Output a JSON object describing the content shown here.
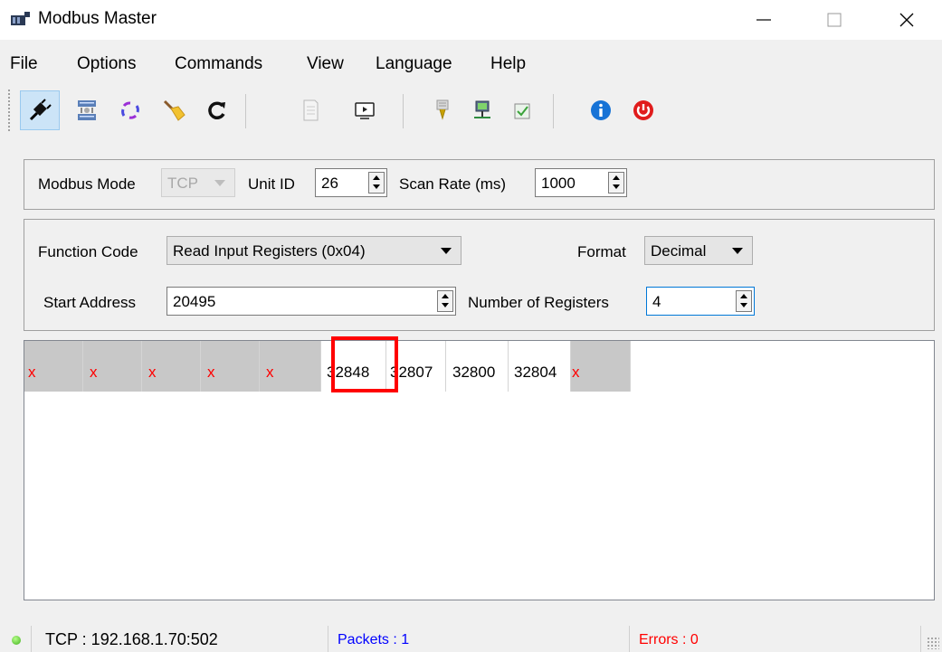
{
  "window": {
    "title": "Modbus Master"
  },
  "menu": [
    "File",
    "Options",
    "Commands",
    "View",
    "Language",
    "Help"
  ],
  "toolbar": {
    "buttons": [
      {
        "icon": "connect-plug-icon",
        "active": true
      },
      {
        "icon": "network-settings-icon"
      },
      {
        "icon": "scan-cycle-icon"
      },
      {
        "icon": "clear-broom-icon"
      },
      {
        "icon": "refresh-icon"
      },
      {
        "icon": "log-document-icon"
      },
      {
        "icon": "bus-monitor-icon"
      },
      {
        "icon": "tools-icon"
      },
      {
        "icon": "network-computer-icon"
      },
      {
        "icon": "checklist-icon"
      },
      {
        "icon": "info-icon"
      },
      {
        "icon": "power-exit-icon"
      }
    ]
  },
  "connection": {
    "modbus_mode_label": "Modbus Mode",
    "modbus_mode_value": "TCP",
    "unit_id_label": "Unit ID",
    "unit_id_value": "26",
    "scan_rate_label": "Scan Rate (ms)",
    "scan_rate_value": "1000"
  },
  "request": {
    "function_code_label": "Function Code",
    "function_code_value": "Read Input Registers (0x04)",
    "format_label": "Format",
    "format_value": "Decimal",
    "start_address_label": "Start Address",
    "start_address_value": "20495",
    "num_registers_label": "Number of Registers",
    "num_registers_value": "4"
  },
  "grid": {
    "cells": [
      "x",
      "x",
      "x",
      "x",
      "x",
      "32848",
      "32807",
      "32800",
      "32804",
      "x"
    ],
    "highlighted_value": "32848"
  },
  "status": {
    "connection": "TCP : 192.168.1.70:502",
    "packets": "Packets : 1",
    "errors": "Errors : 0",
    "packets_color": "#0000ff",
    "errors_color": "#ff0000",
    "connected_color": "#3fae1c"
  }
}
